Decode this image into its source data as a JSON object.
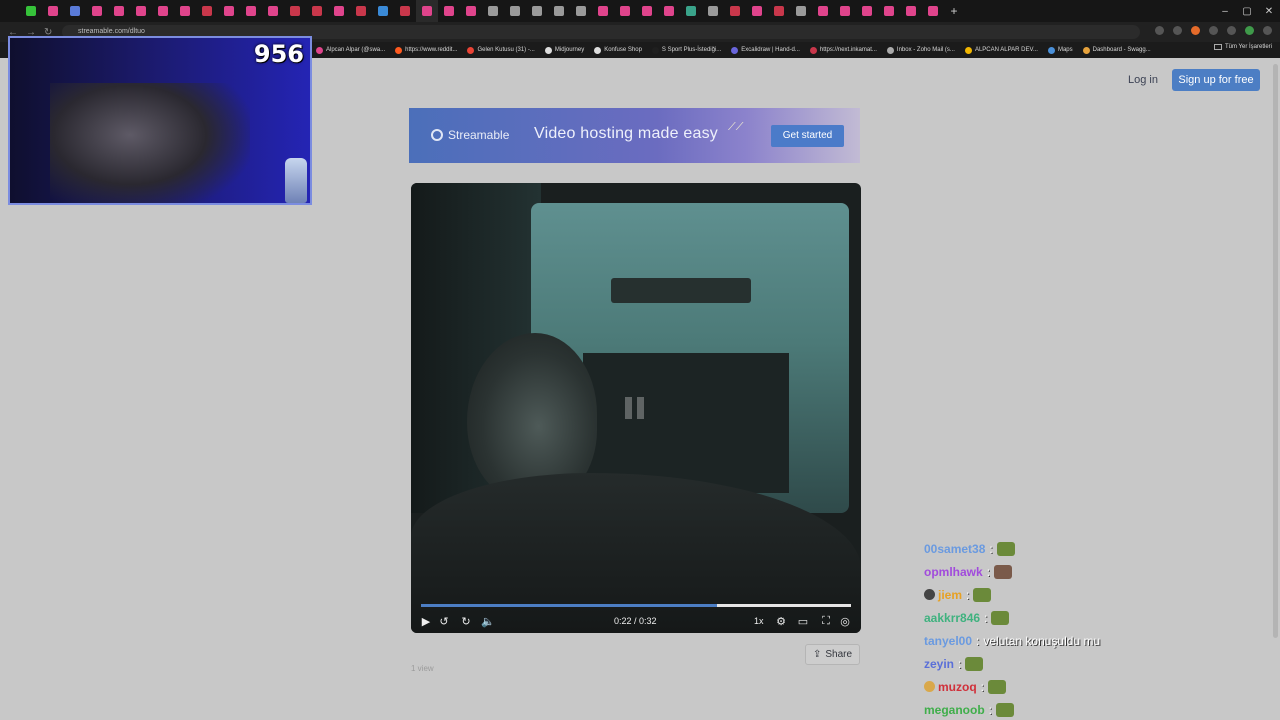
{
  "browser": {
    "url": "streamable.com/dltuo",
    "tab_colors": [
      "#36c23a",
      "#e0448c",
      "#5a7bd8",
      "#e0448c",
      "#e0448c",
      "#e0448c",
      "#e0448c",
      "#e0448c",
      "#c9374b",
      "#e0448c",
      "#e0448c",
      "#e0448c",
      "#c9374b",
      "#c9374b",
      "#e0448c",
      "#c9374b",
      "#3a8ad7",
      "#c9374b",
      "#e0448c",
      "#e0448c",
      "#e0448c",
      "#9a9a9a",
      "#9a9a9a",
      "#9a9a9a",
      "#9a9a9a",
      "#9a9a9a",
      "#e0448c",
      "#e0448c",
      "#e0448c",
      "#e0448c",
      "#3aa38a",
      "#9a9a9a",
      "#c9374b",
      "#e0448c",
      "#c9374b",
      "#9a9a9a",
      "#e0448c",
      "#e0448c",
      "#e0448c",
      "#e0448c",
      "#e0448c",
      "#e0448c"
    ],
    "window_controls": [
      "–",
      "▢",
      "✕"
    ],
    "bookmarks": [
      {
        "label": "Alpcan Alpar (@swa...",
        "color": "#e0448c"
      },
      {
        "label": "https://www.reddit...",
        "color": "#ff5a1f"
      },
      {
        "label": "Gelen Kutusu (31) -...",
        "color": "#ea4335"
      },
      {
        "label": "Midjourney",
        "color": "#dddddd"
      },
      {
        "label": "Konfuse Shop",
        "color": "#dddddd"
      },
      {
        "label": "S Sport Plus-İstediği...",
        "color": "#1f1f1f"
      },
      {
        "label": "Excalidraw | Hand-d...",
        "color": "#6965db"
      },
      {
        "label": "https://next.inkamat...",
        "color": "#c9374b"
      },
      {
        "label": "Inbox - Zoho Mail (s...",
        "color": "#aaaaaa"
      },
      {
        "label": "ALPCAN ALPAR DEV...",
        "color": "#f2b600"
      },
      {
        "label": "Maps",
        "color": "#4a90d9"
      },
      {
        "label": "Dashboard - Swagg...",
        "color": "#e6a23c"
      }
    ],
    "all_bookmarks": "Tüm Yer İşaretleri"
  },
  "header": {
    "login": "Log in",
    "signup": "Sign up for free"
  },
  "banner": {
    "brand": "Streamable",
    "tagline": "Video hosting made easy",
    "cta": "Get started"
  },
  "player": {
    "current_time": "0:22",
    "duration": "0:32",
    "time_label": "0:22 / 0:32",
    "progress_fraction": 0.688,
    "speed": "1x"
  },
  "page": {
    "views": "1 view",
    "share": "Share"
  },
  "webcam": {
    "counter": "956"
  },
  "chat": [
    {
      "user": "00samet38",
      "color": "#6a9ae0",
      "message": "",
      "emote": "#6b8a3a",
      "badge": ""
    },
    {
      "user": "opmlhawk",
      "color": "#a14bdc",
      "message": "",
      "emote": "#7a5a4a",
      "badge": ""
    },
    {
      "user": "jiem",
      "color": "#e7a124",
      "message": "",
      "emote": "#6b8a3a",
      "badge": "#444444"
    },
    {
      "user": "aakkrr846",
      "color": "#3fb27f",
      "message": "",
      "emote": "#6b8a3a",
      "badge": ""
    },
    {
      "user": "tanyel00",
      "color": "#6a9ae0",
      "message": "velutan konuşuldu mu",
      "emote": "",
      "badge": ""
    },
    {
      "user": "zeyin",
      "color": "#5a6fd8",
      "message": "",
      "emote": "#6b8a3a",
      "badge": ""
    },
    {
      "user": "muzoq",
      "color": "#d0303a",
      "message": "",
      "emote": "#6b8a3a",
      "badge": "#d9a84a"
    },
    {
      "user": "meganoob",
      "color": "#3fae4a",
      "message": "",
      "emote": "#6b8a3a",
      "badge": ""
    }
  ]
}
